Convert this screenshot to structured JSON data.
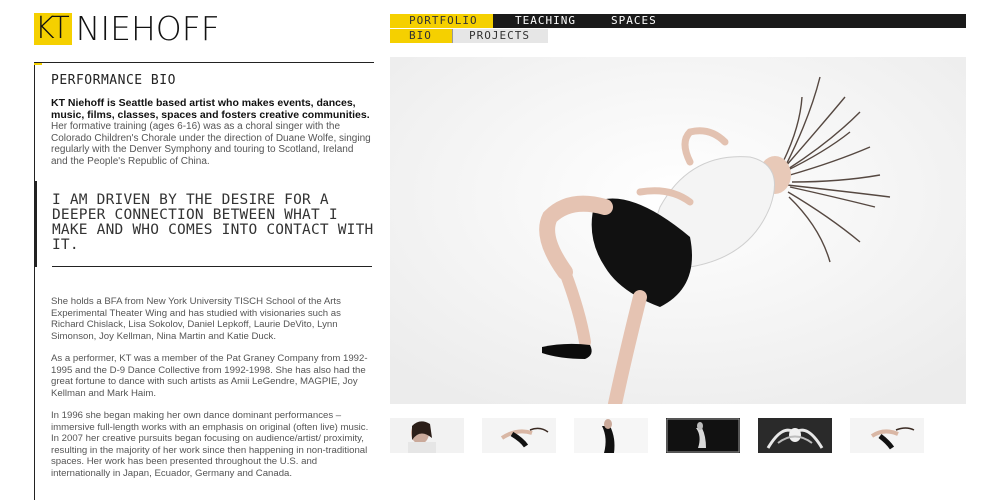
{
  "logo": {
    "kt": "KT",
    "name": "NIEHOFF"
  },
  "nav": {
    "row1": [
      {
        "label": "PORTFOLIO",
        "active": true
      },
      {
        "label": "TEACHING",
        "active": false
      },
      {
        "label": "SPACES",
        "active": false
      }
    ],
    "row2": [
      {
        "label": "BIO",
        "active": true
      },
      {
        "label": "PROJECTS",
        "active": false
      }
    ]
  },
  "bio": {
    "title": "PERFORMANCE BIO",
    "intro_bold": "KT Niehoff is Seattle based artist who makes events, dances, music, films, classes, spaces and fosters creative communities.",
    "intro_rest": " Her formative training (ages 6-16) was as a choral singer with the Colorado Children's Chorale under the direction of Duane Wolfe, singing regularly with the Denver Symphony and touring to Scotland, Ireland and the People's Republic of China.",
    "quote": "I AM DRIVEN BY THE DESIRE FOR A DEEPER CONNECTION BETWEEN WHAT I MAKE AND WHO COMES INTO CONTACT WITH IT.",
    "paragraphs": [
      "She holds a BFA from New York University TISCH School of the Arts Experimental Theater Wing and has studied with visionaries such as Richard Chislack, Lisa Sokolov, Daniel Lepkoff, Laurie DeVito, Lynn Simonson, Joy Kellman, Nina Martin and Katie Duck.",
      "As a performer, KT was a member of the Pat Graney Company from 1992-1995 and the D-9 Dance Collective from 1992-1998. She has also had the great fortune to dance with such artists as Amii LeGendre, MAGPIE, Joy Kellman and Mark Haim.",
      "In 1996 she began making her own dance dominant performances – immersive full-length works with an emphasis on original (often live) music. In 2007 her creative pursuits began focusing on audience/artist/ proximity, resulting in the majority of her work since then happening in non-traditional spaces. Her work has been presented throughout the U.S. and internationally in Japan, Ecuador, Germany and Canada."
    ]
  },
  "colors": {
    "accent": "#f5d000",
    "dark": "#1a1a1a",
    "text": "#555555"
  },
  "gallery": {
    "thumbnail_count": 6,
    "selected_index": 3
  }
}
